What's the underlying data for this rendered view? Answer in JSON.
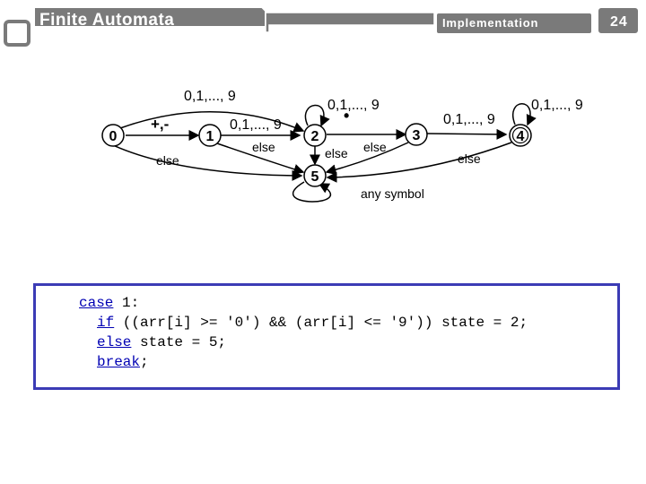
{
  "header": {
    "title": "Finite Automata",
    "section": "Implementation",
    "page_number": "24"
  },
  "colors": {
    "frame": "#7a7a7a",
    "code_border": "#3b3bb5",
    "keyword": "#0000b3"
  },
  "diagram": {
    "states": [
      "0",
      "1",
      "2",
      "3",
      "4",
      "5"
    ],
    "labels": {
      "sign": "+,-",
      "digits": "0,1,..., 9",
      "dot": "•",
      "else": "else",
      "any": "any symbol"
    }
  },
  "code": {
    "case_kw": "case",
    "case_rest": " 1:",
    "if_kw": "if",
    "if_rest": " ((arr[i] >= '0') && (arr[i] <= '9')) state = 2;",
    "else_kw": "else",
    "else_rest": " state = 5;",
    "break_kw": "break",
    "break_rest": ";"
  }
}
